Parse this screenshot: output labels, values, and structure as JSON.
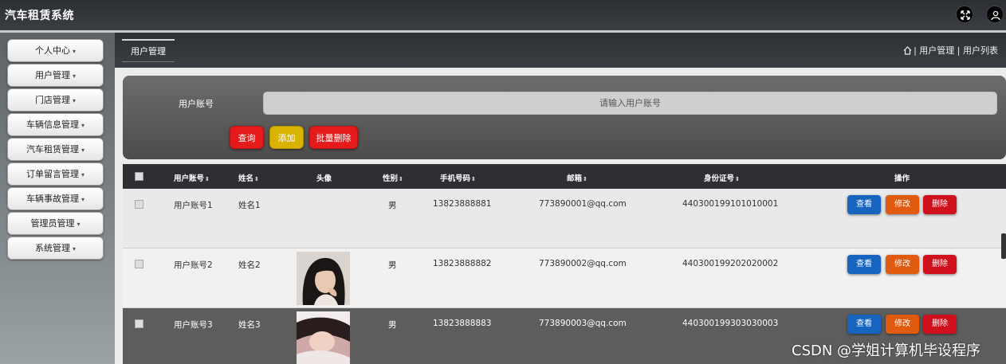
{
  "app": {
    "title": "汽车租赁系统"
  },
  "topbar": {
    "icons": [
      "fullscreen-icon",
      "user-icon"
    ]
  },
  "sidebar": {
    "items": [
      {
        "label": "个人中心"
      },
      {
        "label": "用户管理"
      },
      {
        "label": "门店管理"
      },
      {
        "label": "车辆信息管理"
      },
      {
        "label": "汽车租赁管理"
      },
      {
        "label": "订单留言管理"
      },
      {
        "label": "车辆事故管理"
      },
      {
        "label": "管理员管理"
      },
      {
        "label": "系统管理"
      }
    ],
    "caret": "▾"
  },
  "tabs": {
    "active": "用户管理"
  },
  "breadcrumb": {
    "text": "| 用户管理 | 用户列表"
  },
  "search": {
    "label": "用户账号",
    "placeholder": "请输入用户账号",
    "query_label": "查询",
    "add_label": "添加",
    "batch_delete_label": "批量删除"
  },
  "table": {
    "headers": {
      "account": "用户账号",
      "name": "姓名",
      "avatar": "头像",
      "gender": "性别",
      "phone": "手机号码",
      "email": "邮箱",
      "idcard": "身份证号",
      "actions": "操作",
      "sort_glyph": "⇕"
    },
    "rows": [
      {
        "account": "用户账号1",
        "name": "姓名1",
        "gender": "男",
        "phone": "13823888881",
        "email": "773890001@qq.com",
        "idcard": "440300199101010001",
        "has_avatar": false
      },
      {
        "account": "用户账号2",
        "name": "姓名2",
        "gender": "男",
        "phone": "13823888882",
        "email": "773890002@qq.com",
        "idcard": "440300199202020002",
        "has_avatar": true
      },
      {
        "account": "用户账号3",
        "name": "姓名3",
        "gender": "男",
        "phone": "13823888883",
        "email": "773890003@qq.com",
        "idcard": "440300199303030003",
        "has_avatar": true
      }
    ],
    "action_labels": {
      "view": "查看",
      "edit": "修改",
      "delete": "删除"
    }
  },
  "watermark": "CSDN @学姐计算机毕设程序",
  "colors": {
    "query_button": "#e51b1b",
    "add_button": "#d9b300",
    "batch_delete_button": "#e51b1b",
    "view_button": "#1565c0",
    "edit_button": "#e05a10",
    "delete_button": "#d0101c"
  }
}
